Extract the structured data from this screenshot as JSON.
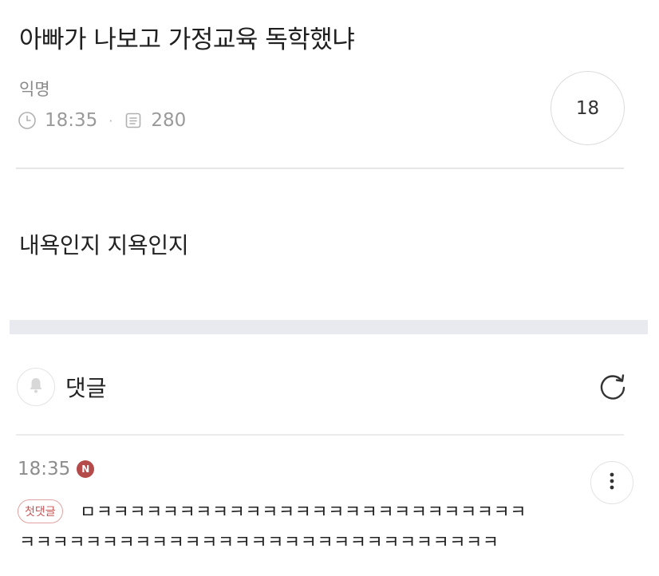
{
  "post": {
    "title": "아빠가 나보고 가정교육 독학했냐",
    "author": "익명",
    "time": "18:35",
    "separator": "·",
    "views": "280",
    "likes": "18",
    "content": "내욕인지 지욕인지"
  },
  "comments_section": {
    "title": "댓글",
    "icons": {
      "bell": "bell-icon",
      "refresh": "refresh-icon"
    }
  },
  "comments": [
    {
      "time": "18:35",
      "new_badge": "N",
      "first_badge": "첫댓글",
      "line1": "ㅁㅋㅋㅋㅋㅋㅋㅋㅋㅋㅋㅋㅋㅋㅋㅋㅋㅋㅋㅋㅋㅋㅋㅋㅋㅋㅋ",
      "line2": "ㅋㅋㅋㅋㅋㅋㅋㅋㅋㅋㅋㅋㅋㅋㅋㅋㅋㅋㅋㅋㅋㅋㅋㅋㅋㅋㅋㅋㅋ"
    }
  ],
  "colors": {
    "badge_red": "#b44a4a",
    "first_badge_border": "#e3a2a2",
    "band": "#e9eaef"
  }
}
